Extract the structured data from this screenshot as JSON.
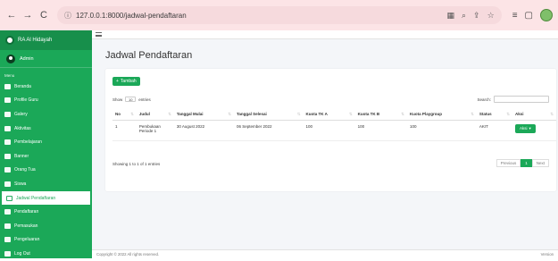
{
  "browser": {
    "url": "127.0.0.1:8000/jadwal-pendaftaran"
  },
  "brand": {
    "name": "RA Al Hidayah"
  },
  "user": {
    "name": "Admin"
  },
  "sidebar": {
    "header": "Menu",
    "items": [
      {
        "label": "Beranda",
        "icon": "home-icon"
      },
      {
        "label": "Profile Guru",
        "icon": "id-card-icon"
      },
      {
        "label": "Galery",
        "icon": "image-icon"
      },
      {
        "label": "Aktivitas",
        "icon": "chart-icon"
      },
      {
        "label": "Pembelajaran",
        "icon": "book-icon"
      },
      {
        "label": "Banner",
        "icon": "banner-icon"
      },
      {
        "label": "Orang Tua",
        "icon": "users-icon"
      },
      {
        "label": "Siswa",
        "icon": "students-icon"
      },
      {
        "label": "Jadwal Pendaftaran",
        "icon": "calendar-icon",
        "active": true
      },
      {
        "label": "Pendaftaran",
        "icon": "form-icon"
      },
      {
        "label": "Pemasukan",
        "icon": "income-icon"
      },
      {
        "label": "Pengeluaran",
        "icon": "expense-icon"
      },
      {
        "label": "Log Out",
        "icon": "logout-icon"
      }
    ]
  },
  "page": {
    "title": "Jadwal Pendaftaran",
    "add_button": "Tambah",
    "show_label": "Show",
    "show_value": "10",
    "entries_label": "entries",
    "search_label": "Search:",
    "columns": [
      "No",
      "Judul",
      "Tanggal Mulai",
      "Tanggal Selesai",
      "Kuota TK A",
      "Kuota TK B",
      "Kuota Playgroup",
      "Status",
      "Aksi"
    ],
    "rows": [
      {
        "no": "1",
        "judul": "Pembukaan Periode 1",
        "mulai": "30 August 2022",
        "selesai": "06 September 2022",
        "tka": "100",
        "tkb": "100",
        "playgroup": "100",
        "status": "AKIT",
        "aksi": "Aksi"
      }
    ],
    "info": "Showing 1 to 1 of 1 entries",
    "prev": "Previous",
    "current_page": "1",
    "next": "Next"
  },
  "footer": {
    "copyright": "Copyright © 2022 All rights reserved.",
    "version": "Version"
  },
  "colors": {
    "accent": "#1ba858",
    "chrome": "#fce4e6"
  }
}
